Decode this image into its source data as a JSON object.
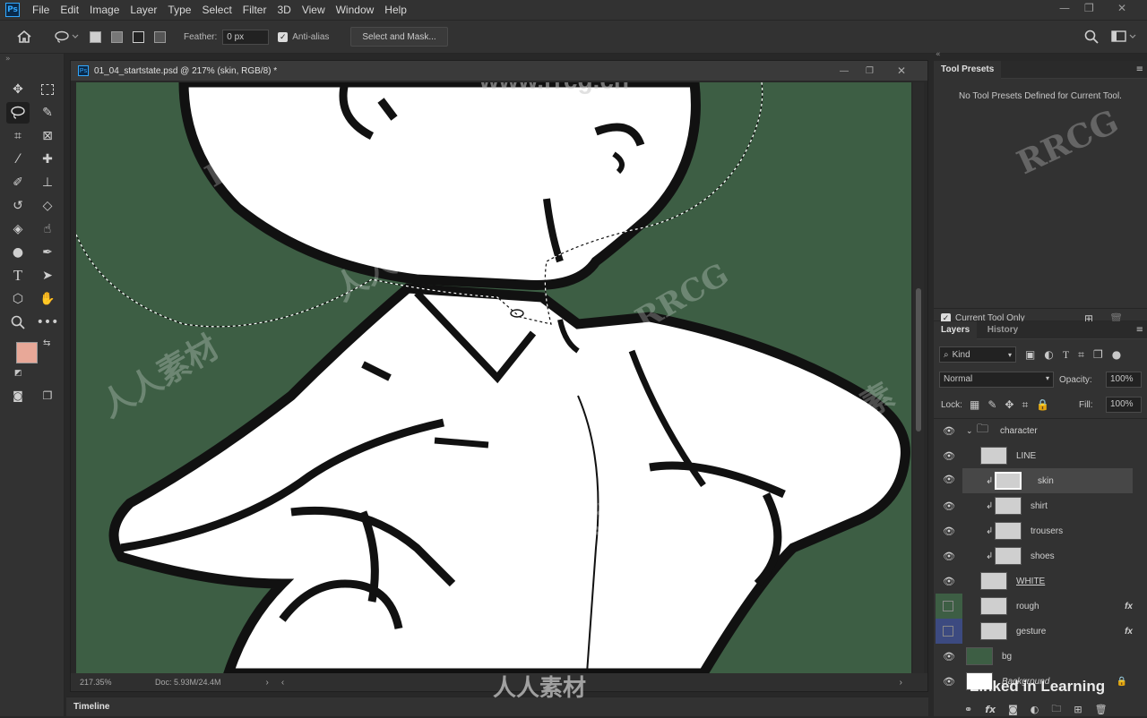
{
  "app": {
    "logo_text": "Ps"
  },
  "menu": [
    "File",
    "Edit",
    "Image",
    "Layer",
    "Type",
    "Select",
    "Filter",
    "3D",
    "View",
    "Window",
    "Help"
  ],
  "window_controls": {
    "minimize": "—",
    "restore": "❐",
    "close": "✕"
  },
  "options": {
    "feather_label": "Feather:",
    "feather_value": "0 px",
    "antialias_label": "Anti-alias",
    "select_mask_label": "Select and Mask..."
  },
  "document": {
    "tab_title": "01_04_startstate.psd @ 217% (skin, RGB/8) *",
    "zoom": "217.35%",
    "doc_size": "Doc: 5.93M/24.4M"
  },
  "timeline_label": "Timeline",
  "presets": {
    "tab": "Tool Presets",
    "empty_msg": "No Tool Presets Defined for Current Tool.",
    "current_only": "Current Tool Only"
  },
  "layers_panel": {
    "tabs": [
      "Layers",
      "History"
    ],
    "kind": "Kind",
    "blend": "Normal",
    "opacity_label": "Opacity:",
    "opacity": "100%",
    "lock_label": "Lock:",
    "fill_label": "Fill:",
    "fill": "100%",
    "layers": [
      {
        "name": "character",
        "group": true
      },
      {
        "name": "LINE"
      },
      {
        "name": "skin",
        "selected": true,
        "clipped": true
      },
      {
        "name": "shirt",
        "clipped": true
      },
      {
        "name": "trousers",
        "clipped": true
      },
      {
        "name": "shoes",
        "clipped": true
      },
      {
        "name": "WHITE"
      },
      {
        "name": "rough",
        "fx": "fx"
      },
      {
        "name": "gesture",
        "fx": "fx"
      },
      {
        "name": "bg"
      },
      {
        "name": "Background"
      }
    ]
  },
  "colors": {
    "foreground": "#e8a898",
    "background": "#ffffff",
    "canvas_bg": "#3d5e44"
  },
  "watermarks": {
    "site": "www.rrcg.cn",
    "cn": "人人素材",
    "brand": "RRCG",
    "linkedin": "Linked in Learning"
  }
}
